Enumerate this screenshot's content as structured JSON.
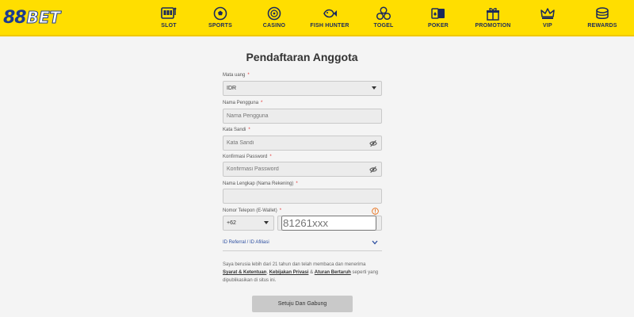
{
  "brand": {
    "logo_num": "88",
    "logo_text": "BET"
  },
  "nav": [
    {
      "label": "SLOT",
      "icon": "slot-machine-icon"
    },
    {
      "label": "SPORTS",
      "icon": "soccer-ball-icon"
    },
    {
      "label": "CASINO",
      "icon": "roulette-icon"
    },
    {
      "label": "FISH HUNTER",
      "icon": "fish-icon"
    },
    {
      "label": "TOGEL",
      "icon": "lottery-balls-icon"
    },
    {
      "label": "POKER",
      "icon": "playing-cards-icon"
    },
    {
      "label": "PROMOTION",
      "icon": "gift-icon"
    },
    {
      "label": "VIP",
      "icon": "crown-icon"
    },
    {
      "label": "REWARDS",
      "icon": "coins-icon"
    }
  ],
  "form": {
    "title": "Pendaftaran Anggota",
    "currency": {
      "label": "Mata uang",
      "required": "*",
      "value": "IDR"
    },
    "username": {
      "label": "Nama Pengguna",
      "required": "*",
      "placeholder": "Nama Pengguna"
    },
    "password": {
      "label": "Kata Sandi",
      "required": "*",
      "placeholder": "Kata Sandi"
    },
    "confirm_password": {
      "label": "Konfirmasi Password",
      "required": "*",
      "placeholder": "Konfirmasi Password"
    },
    "full_name": {
      "label": "Nama Lengkap (Nama Rekening)",
      "required": "*",
      "placeholder": ""
    },
    "phone": {
      "label": "Nomor Telepon (E-Wallet)",
      "required": "*",
      "code": "+62",
      "placeholder": "81261xxx"
    },
    "referral": {
      "label": "ID Referral / ID Afiliasi"
    },
    "terms": {
      "text_1": "Saya berusia lebih dari 21 tahun dan telah membaca dan menerima",
      "link_1": "Syarat & Ketentuan",
      "sep_1": ",",
      "link_2": "Kebijakan Privasi",
      "sep_2": "&",
      "link_3": "Aturan Bertaruh",
      "text_2": "seperti yang dipublikasikan di situs ini."
    },
    "submit_label": "Setuju Dan Gabung"
  },
  "colors": {
    "header": "#ffde00",
    "brand_blue": "#1d3c8f",
    "required": "#e53030",
    "link": "#2d4fa0"
  }
}
